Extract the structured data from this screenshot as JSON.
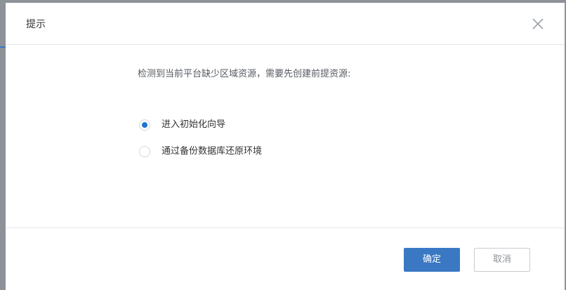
{
  "dialog": {
    "title": "提示",
    "close_icon": "close-icon",
    "message": "检测到当前平台缺少区域资源，需要先创建前提资源:",
    "options": [
      {
        "label": "进入初始化向导",
        "checked": true
      },
      {
        "label": "通过备份数据库还原环境",
        "checked": false
      }
    ],
    "buttons": {
      "confirm_label": "确定",
      "cancel_label": "取消"
    }
  },
  "colors": {
    "accent": "#3a78c3",
    "radio_checked": "#1a76d2",
    "overlay": "#8d9299"
  }
}
